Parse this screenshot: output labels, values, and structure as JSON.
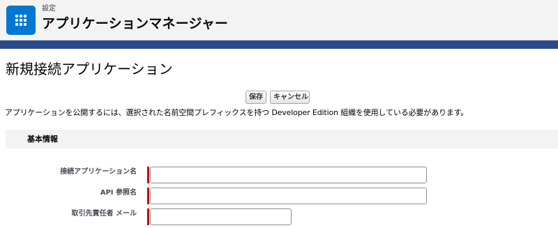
{
  "header": {
    "eyebrow": "設定",
    "title": "アプリケーションマネージャー"
  },
  "page": {
    "title": "新規接続アプリケーション",
    "notice": "アプリケーションを公開するには、選択された名前空間プレフィックスを持つ Developer Edition 組織を使用している必要があります。"
  },
  "buttons": {
    "save": "保存",
    "cancel": "キャンセル"
  },
  "section": {
    "title": "基本情報"
  },
  "fields": [
    {
      "label": "接続アプリケーション名",
      "value": "",
      "required": true
    },
    {
      "label": "API 参照名",
      "value": "",
      "required": true
    },
    {
      "label": "取引先責任者 メール",
      "value": "",
      "required": true
    }
  ],
  "colors": {
    "app_icon": "#0176d3",
    "brand_band": "#2a4a8d",
    "required_marker": "#c00000"
  },
  "icons": {
    "app_launcher": "app-launcher-grid-icon"
  }
}
